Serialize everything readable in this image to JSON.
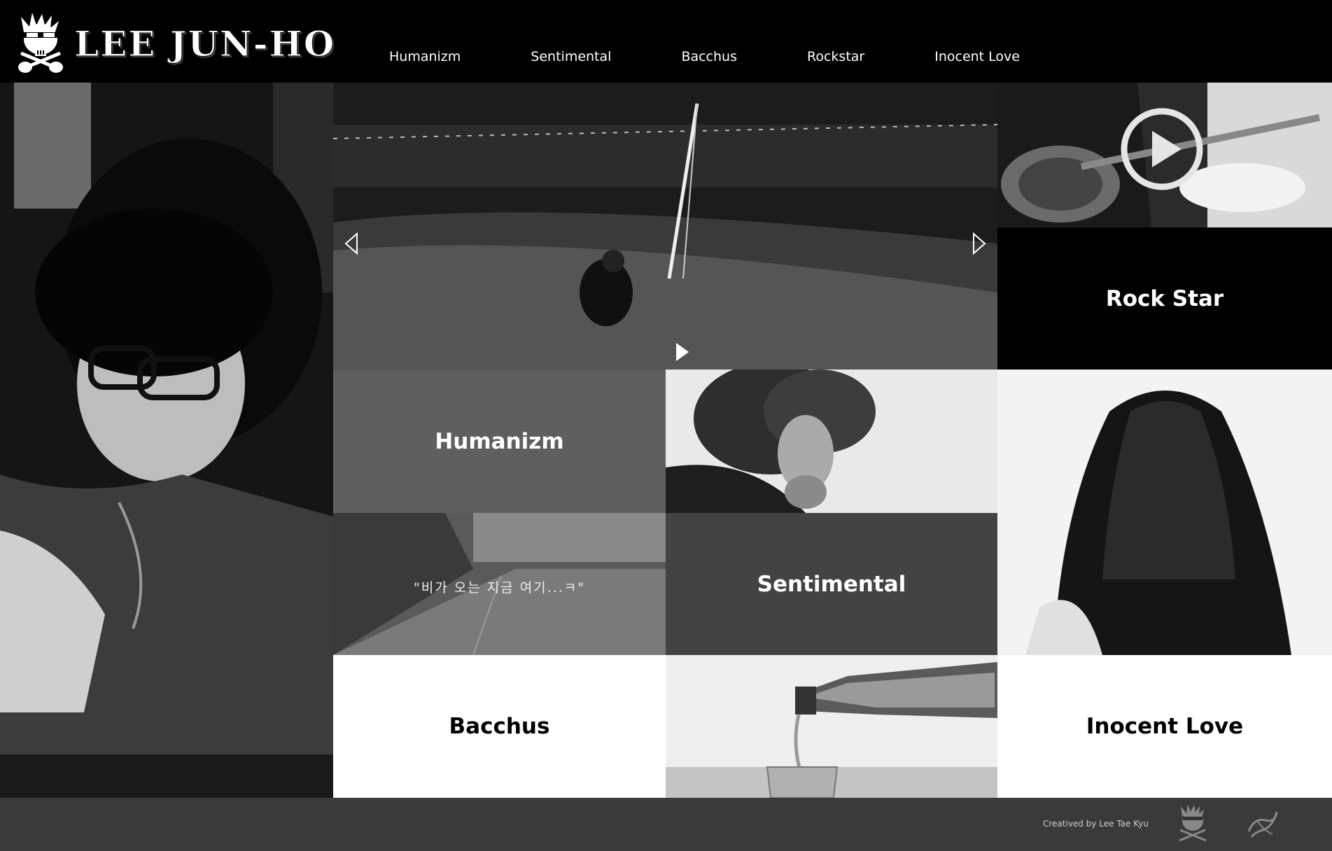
{
  "header": {
    "logo_text": "LEE JUN-HO",
    "nav": [
      "Humanizm",
      "Sentimental",
      "Bacchus",
      "Rockstar",
      "Inocent Love"
    ]
  },
  "tiles": {
    "rock_star": "Rock Star",
    "humanizm": "Humanizm",
    "sentimental": "Sentimental",
    "bacchus": "Bacchus",
    "inocent_love": "Inocent Love",
    "rain_caption": "\"비가 오는 지금 여기...ㅋ\""
  },
  "icons": {
    "logo": "skull-guitar-icon",
    "slider_prev": "triangle-left-outline-icon",
    "slider_next": "triangle-right-outline-icon",
    "slider_play": "play-icon",
    "video_play": "play-circle-icon",
    "footer_logo_1": "skull-guitar-icon",
    "footer_logo_2": "signature-logo-icon"
  },
  "footer": {
    "credit": "Creatived by Lee Tae Kyu"
  },
  "colors": {
    "header_bg": "#000000",
    "footer_bg": "#3a3a3a",
    "humanizm_bg": "#5f5f5f",
    "sentimental_bg": "#434343"
  }
}
